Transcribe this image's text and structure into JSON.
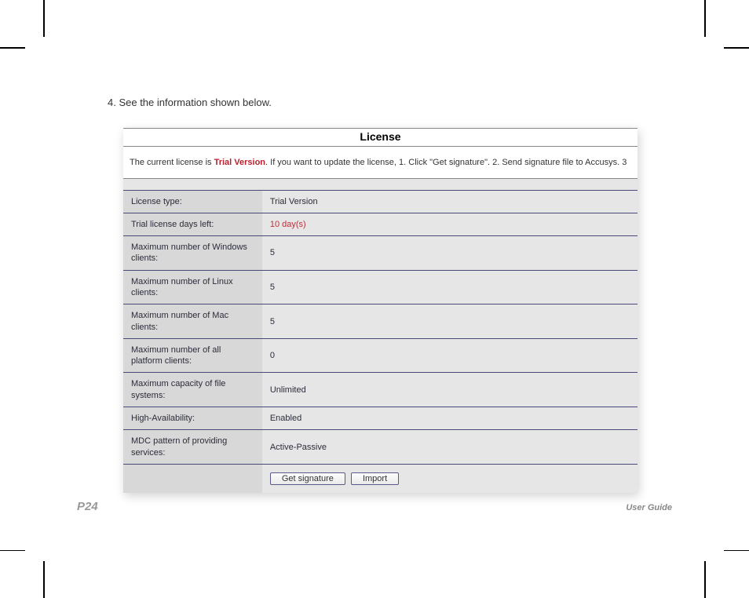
{
  "step": "4. See the information shown below.",
  "panel": {
    "title": "License",
    "notice_pre": "The current license is ",
    "notice_trial": "Trial Version",
    "notice_post": ". If you want to update the license, 1. Click \"Get signature\". 2. Send signature file to Accusys. 3"
  },
  "rows": [
    {
      "label": "License type:",
      "value": "Trial Version",
      "red": false
    },
    {
      "label": "Trial license days left:",
      "value": "10 day(s)",
      "red": true
    },
    {
      "label": "Maximum number of Windows clients:",
      "value": "5",
      "red": false
    },
    {
      "label": "Maximum number of Linux clients:",
      "value": "5",
      "red": false
    },
    {
      "label": "Maximum number of Mac clients:",
      "value": "5",
      "red": false
    },
    {
      "label": "Maximum number of all platform clients:",
      "value": "0",
      "red": false
    },
    {
      "label": "Maximum capacity of file systems:",
      "value": "Unlimited",
      "red": false
    },
    {
      "label": "High-Availability:",
      "value": "Enabled",
      "red": false
    },
    {
      "label": "MDC pattern of providing services:",
      "value": "Active-Passive",
      "red": false
    }
  ],
  "buttons": {
    "get_signature": "Get signature",
    "import": "Import"
  },
  "footer": {
    "page": "P24",
    "guide": "User Guide"
  }
}
